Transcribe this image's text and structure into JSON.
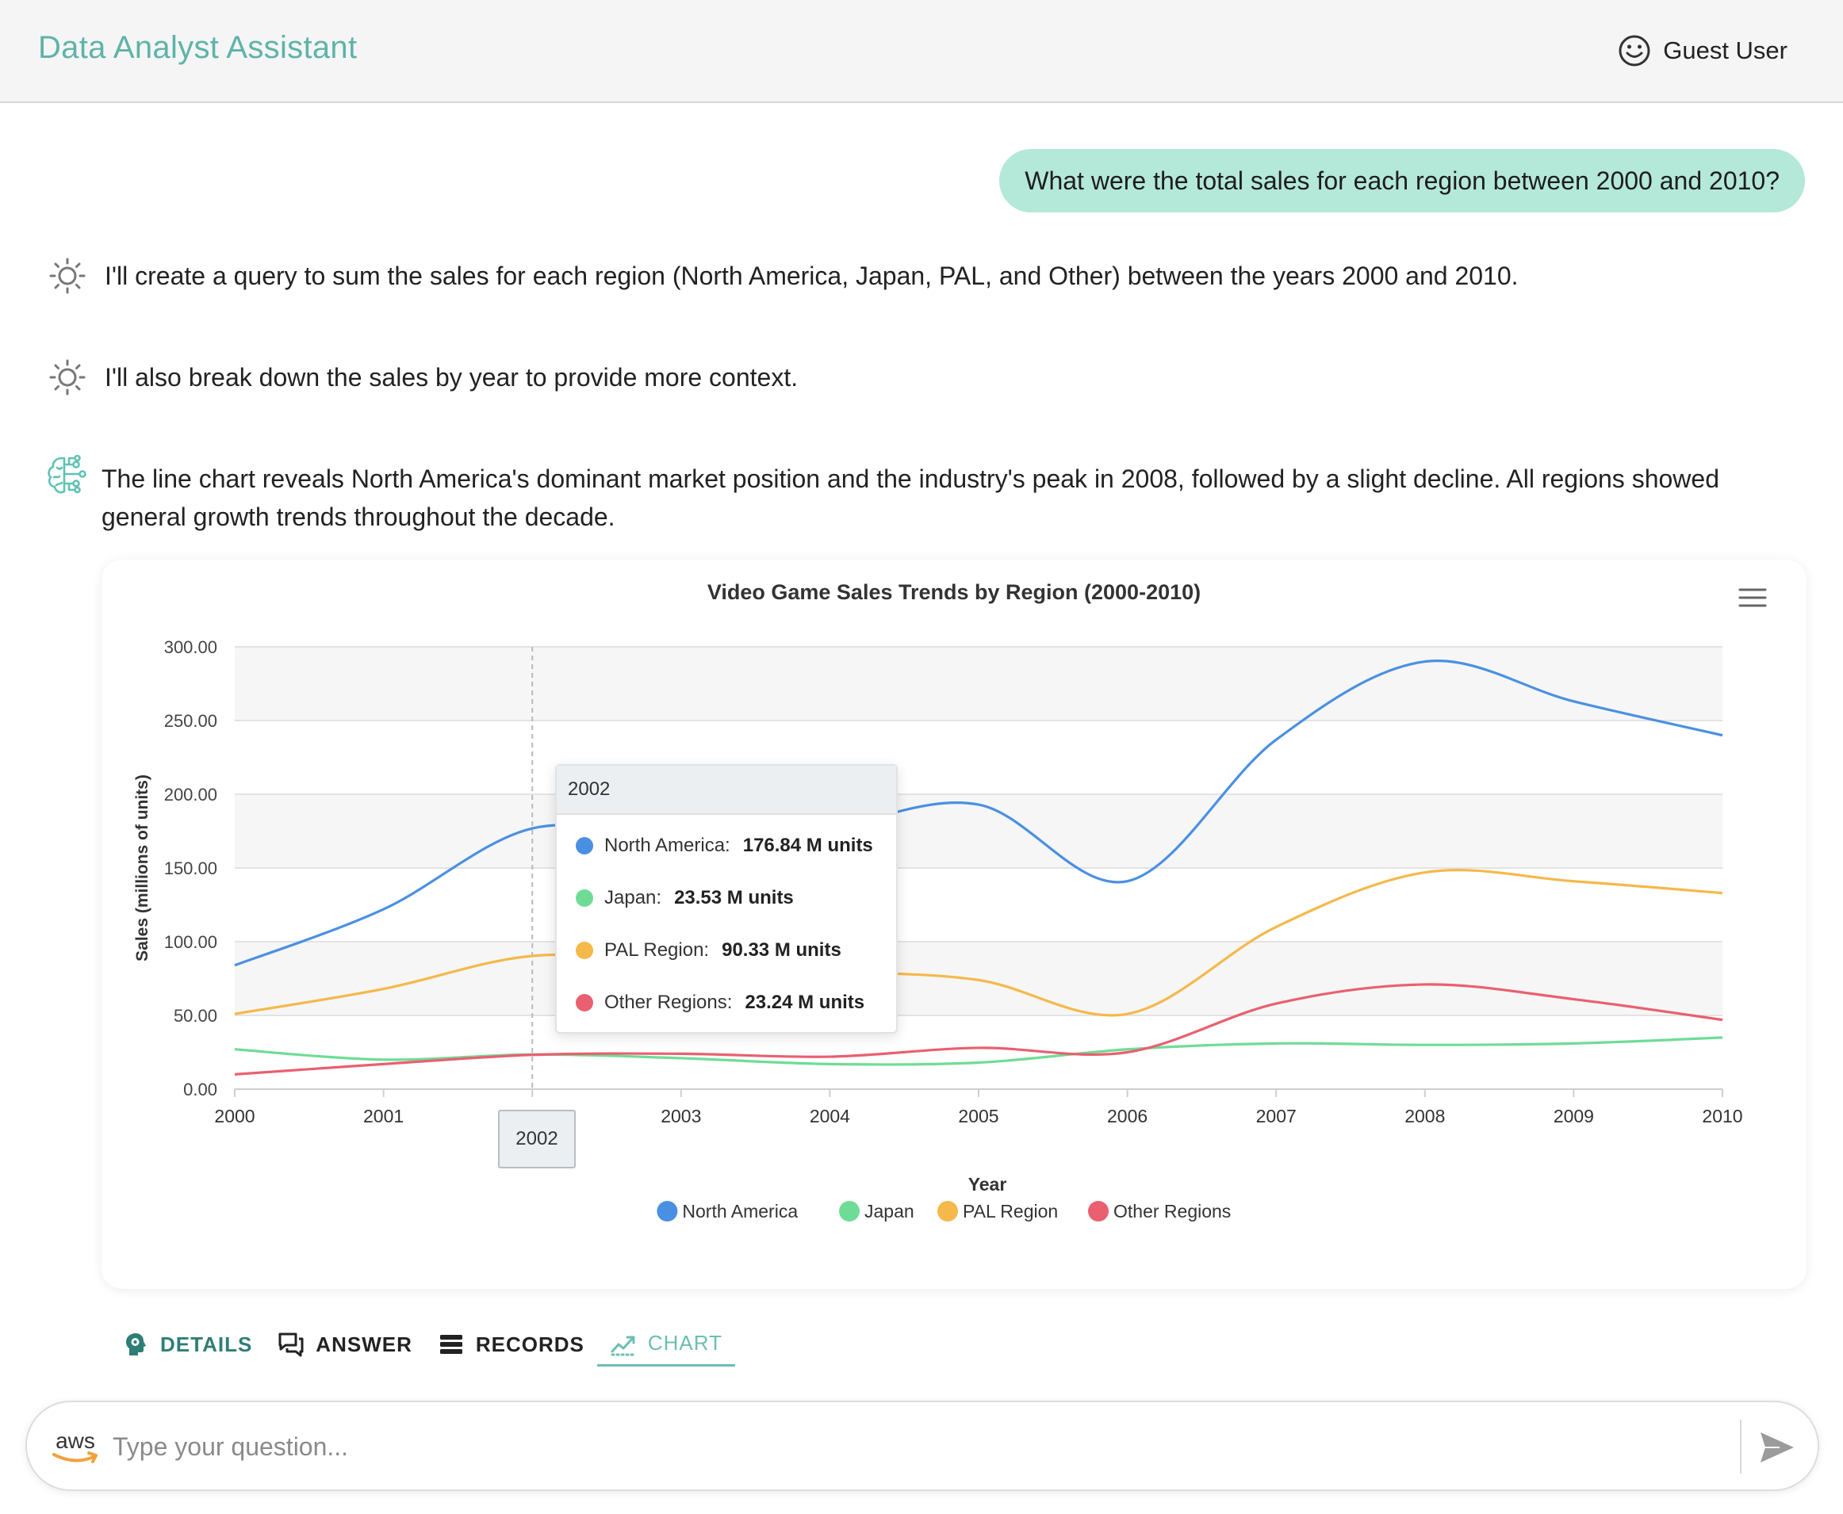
{
  "header": {
    "title": "Data Analyst Assistant",
    "user_name": "Guest User",
    "user_icon": "smiley-face-icon"
  },
  "conversation": {
    "user_question": "What were the total sales for each region between 2000 and 2010?",
    "thoughts": [
      "I'll create a query to sum the sales for each region (North America, Japan, PAL, and Other) between the years 2000 and 2010.",
      "I'll also break down the sales by year to provide more context."
    ],
    "answer": "The line chart reveals North America's dominant market position and the industry's peak in 2008, followed by a slight decline. All regions showed general growth trends throughout the decade."
  },
  "chart_data": {
    "type": "line",
    "title": "Video Game Sales Trends by Region (2000-2010)",
    "xlabel": "Year",
    "ylabel": "Sales (millions of units)",
    "x": [
      "2000",
      "2001",
      "2002",
      "2003",
      "2004",
      "2005",
      "2006",
      "2007",
      "2008",
      "2009",
      "2010"
    ],
    "ylim": [
      0,
      300
    ],
    "yticks": [
      "0.00",
      "50.00",
      "100.00",
      "150.00",
      "200.00",
      "250.00",
      "300.00"
    ],
    "grid": true,
    "legend": "bottom",
    "series": [
      {
        "name": "North America",
        "color": "#4a90e2",
        "values": [
          84,
          122,
          176.84,
          170,
          178,
          193,
          141,
          237,
          290,
          263,
          240
        ]
      },
      {
        "name": "Japan",
        "color": "#6fdc96",
        "values": [
          27,
          20,
          23.53,
          21,
          17,
          18,
          27,
          31,
          30,
          31,
          35
        ]
      },
      {
        "name": "PAL Region",
        "color": "#f5b84a",
        "values": [
          51,
          68,
          90.33,
          86,
          80,
          74,
          51,
          110,
          147,
          141,
          133
        ]
      },
      {
        "name": "Other Regions",
        "color": "#e96070",
        "values": [
          10,
          17,
          23.24,
          24,
          22,
          28,
          25,
          58,
          71,
          61,
          47
        ]
      }
    ],
    "tooltip": {
      "title": "2002",
      "rows": [
        {
          "name": "North America:",
          "value": "176.84 M units",
          "color": "#4a90e2"
        },
        {
          "name": "Japan:",
          "value": "23.53 M units",
          "color": "#6fdc96"
        },
        {
          "name": "PAL Region:",
          "value": "90.33 M units",
          "color": "#f5b84a"
        },
        {
          "name": "Other Regions:",
          "value": "23.24 M units",
          "color": "#e96070"
        }
      ]
    },
    "hovered_x": "2002"
  },
  "tabs": [
    {
      "label": "DETAILS",
      "icon": "brain-gear-icon"
    },
    {
      "label": "ANSWER",
      "icon": "chat-bubbles-icon"
    },
    {
      "label": "RECORDS",
      "icon": "list-icon"
    },
    {
      "label": "CHART",
      "icon": "trend-chart-icon"
    }
  ],
  "input": {
    "placeholder": "Type your question...",
    "logo": "aws"
  },
  "colors": {
    "accent": "#5fb3a8",
    "bubble": "#b4e8d9"
  }
}
